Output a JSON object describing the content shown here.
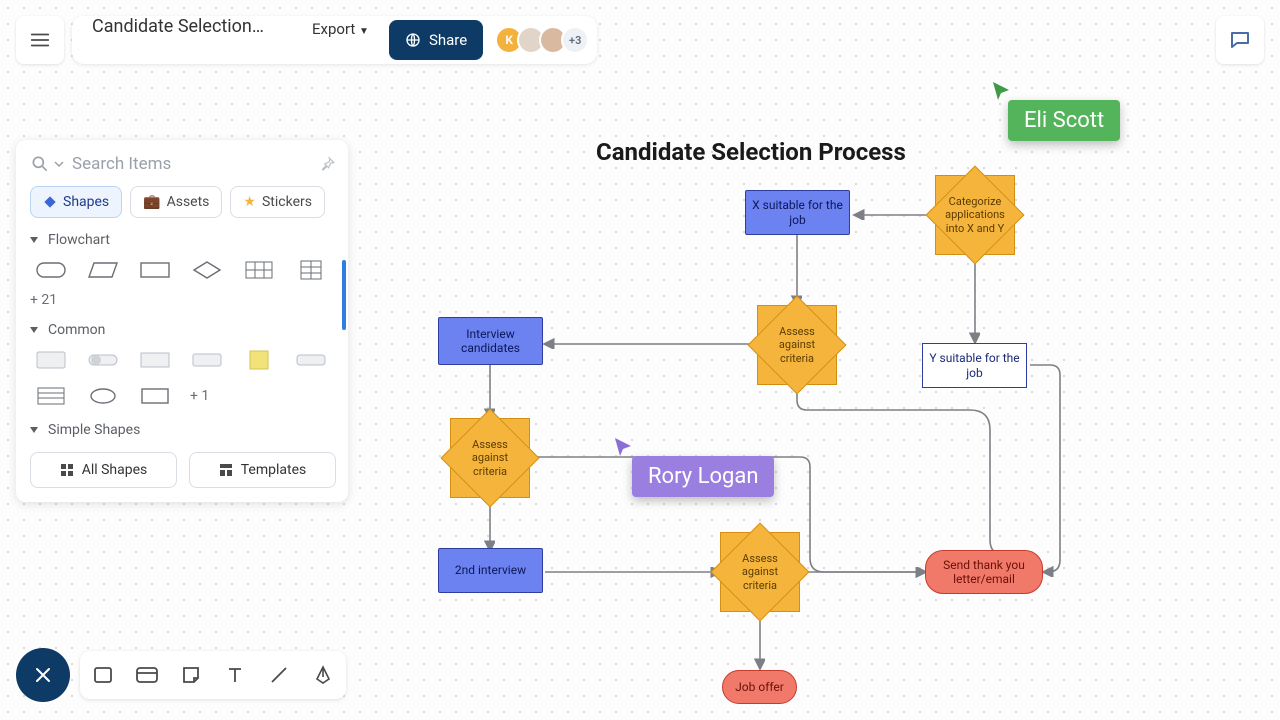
{
  "document": {
    "title": "Candidate Selection Pro…"
  },
  "toolbar": {
    "export_label": "Export",
    "share_label": "Share",
    "avatar_initial": "K",
    "avatar_more": "+3"
  },
  "panel": {
    "search_placeholder": "Search Items",
    "tabs": {
      "shapes": "Shapes",
      "assets": "Assets",
      "stickers": "Stickers"
    },
    "sections": {
      "flowchart": "Flowchart",
      "flowchart_more": "+ 21",
      "common": "Common",
      "common_more": "+ 1",
      "simple": "Simple Shapes"
    },
    "footer": {
      "all_shapes": "All Shapes",
      "templates": "Templates"
    }
  },
  "presence": {
    "user1": "Eli Scott",
    "user2": "Rory Logan"
  },
  "diagram": {
    "title": "Candidate Selection Process",
    "nodes": {
      "categorize": "Categorize applications into X and Y",
      "x_suitable": "X suitable for the job",
      "y_suitable": "Y suitable for the job",
      "assess1": "Assess against criteria",
      "interview": "Interview candidates",
      "assess2": "Assess against criteria",
      "second_interview": "2nd interview",
      "assess3": "Assess against criteria",
      "thank_you": "Send thank you letter/email",
      "job_offer": "Job offer"
    }
  }
}
